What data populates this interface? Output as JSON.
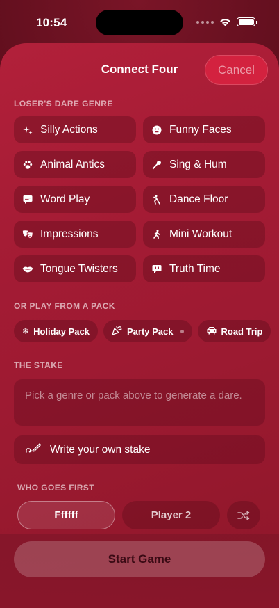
{
  "status": {
    "time": "10:54"
  },
  "header": {
    "title": "Connect Four",
    "cancel_label": "Cancel"
  },
  "sections": {
    "genre_label": "LOSER'S DARE GENRE",
    "pack_label": "OR PLAY FROM A PACK",
    "stake_label": "THE STAKE",
    "first_label": "WHO GOES FIRST"
  },
  "genres": [
    {
      "label": "Silly Actions",
      "icon": "sparkle-icon"
    },
    {
      "label": "Funny Faces",
      "icon": "face-icon"
    },
    {
      "label": "Animal Antics",
      "icon": "paw-icon"
    },
    {
      "label": "Sing & Hum",
      "icon": "microphone-icon"
    },
    {
      "label": "Word Play",
      "icon": "speech-bubble-icon"
    },
    {
      "label": "Dance Floor",
      "icon": "dancer-icon"
    },
    {
      "label": "Impressions",
      "icon": "theater-masks-icon"
    },
    {
      "label": "Mini Workout",
      "icon": "runner-icon"
    },
    {
      "label": "Tongue Twisters",
      "icon": "lips-icon"
    },
    {
      "label": "Truth Time",
      "icon": "quote-bubble-icon"
    }
  ],
  "packs": [
    {
      "label": "Holiday Pack",
      "icon": "snowflake-icon"
    },
    {
      "label": "Party Pack",
      "icon": "party-popper-icon"
    },
    {
      "label": "Road Trip",
      "icon": "car-icon"
    }
  ],
  "stake": {
    "placeholder": "Pick a genre or pack above to generate a dare.",
    "write_own_label": "Write your own stake"
  },
  "players": {
    "player1": "Ffffff",
    "player2": "Player 2",
    "selected": "player1"
  },
  "start_label": "Start Game",
  "colors": {
    "accent": "#d3223f",
    "sheet": "#a31b34",
    "background": "#5e0f1e"
  }
}
